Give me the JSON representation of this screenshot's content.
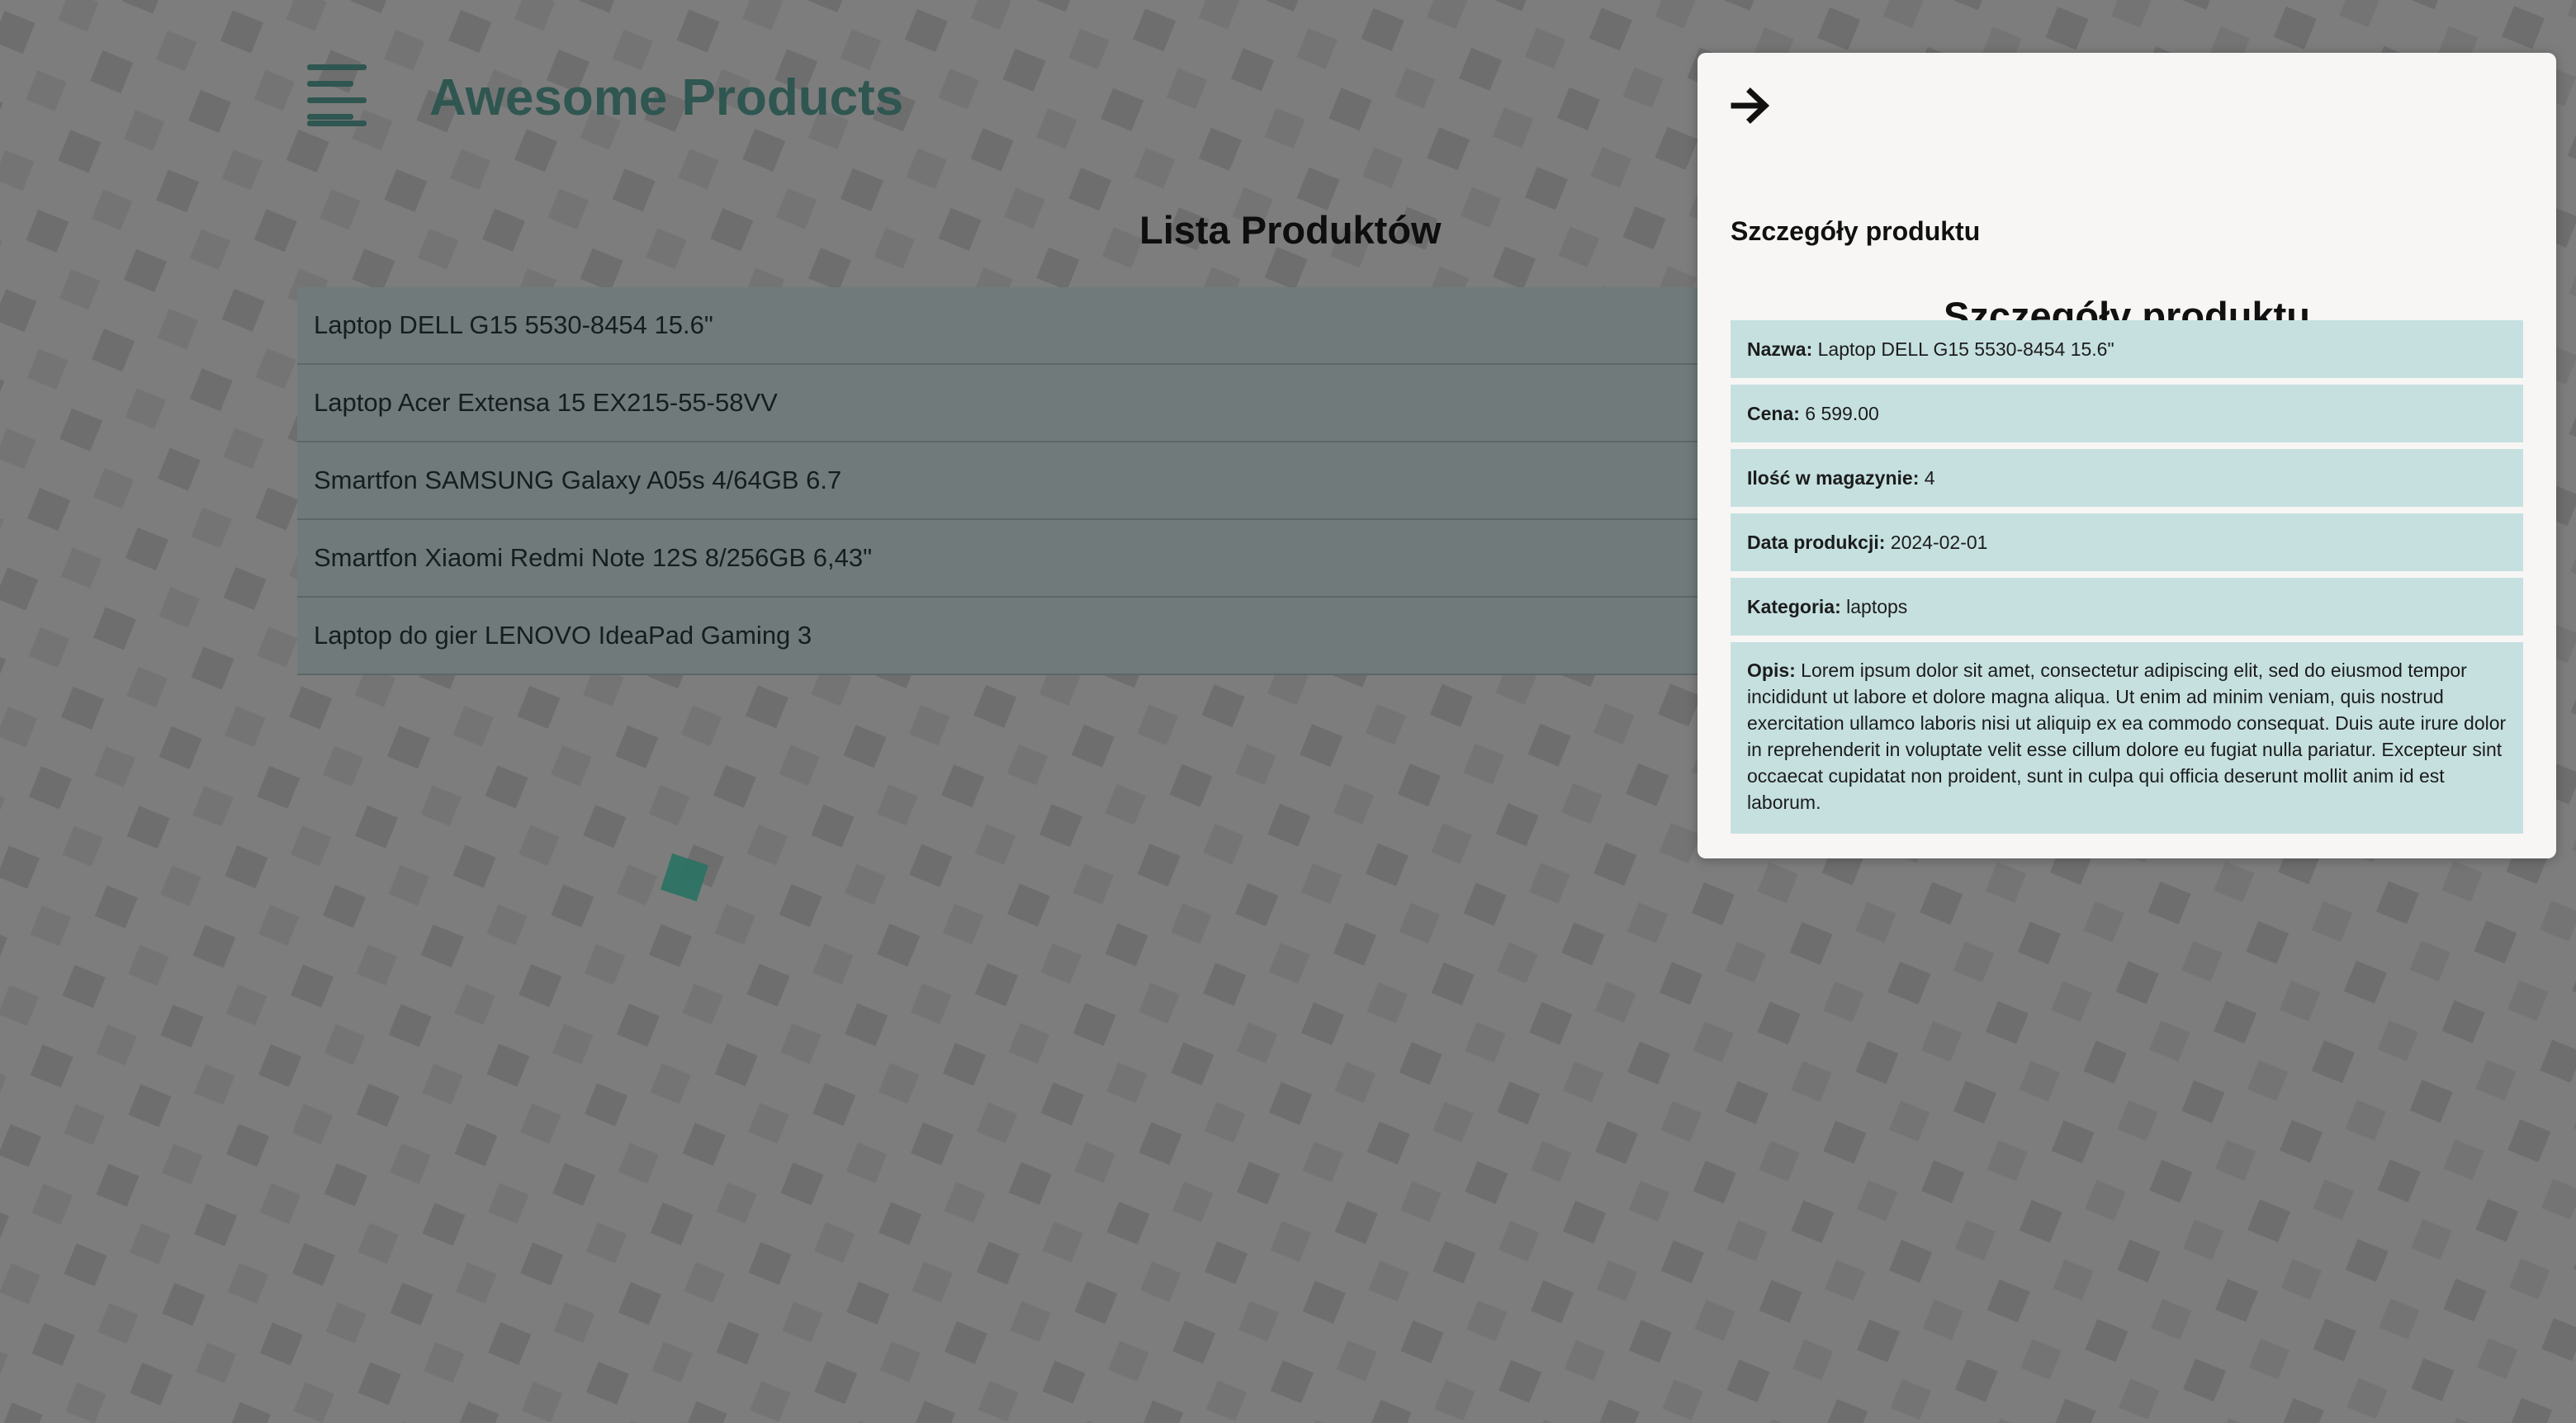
{
  "app": {
    "title": "Awesome Products",
    "menu_icon": "hamburger-menu-icon"
  },
  "products": {
    "heading": "Lista Produktów",
    "items": [
      "Laptop DELL G15 5530-8454 15.6\"",
      "Laptop Acer Extensa 15 EX215-55-58VV",
      "Smartfon SAMSUNG Galaxy A05s 4/64GB 6.7",
      "Smartfon Xiaomi Redmi Note 12S 8/256GB 6,43\"",
      "Laptop do gier LENOVO IdeaPad Gaming 3"
    ]
  },
  "details": {
    "close_icon": "arrow-right-icon",
    "title": "Szczegóły produktu",
    "heading": "Szczegóły produktu",
    "fields": [
      {
        "label": "Nazwa:",
        "value": "Laptop DELL G15 5530-8454 15.6\""
      },
      {
        "label": "Cena:",
        "value": "6 599.00"
      },
      {
        "label": "Ilość w magazynie:",
        "value": "4"
      },
      {
        "label": "Data produkcji:",
        "value": "2024-02-01"
      },
      {
        "label": "Kategoria:",
        "value": "laptops"
      },
      {
        "label": "Opis:",
        "value": "Lorem ipsum dolor sit amet, consectetur adipiscing elit, sed do eiusmod tempor incididunt ut labore et dolore magna aliqua. Ut enim ad minim veniam, quis nostrud exercitation ullamco laboris nisi ut aliquip ex ea commodo consequat. Duis aute irure dolor in reprehenderit in voluptate velit esse cillum dolore eu fugiat nulla pariatur. Excepteur sint occaecat cupidatat non proident, sunt in culpa qui officia deserunt mollit anim id est laborum."
      }
    ]
  },
  "colors": {
    "brand": "#2f5650",
    "list_row": "#707a7b",
    "panel_bg": "#f7f6f4",
    "detail_row": "#c6e0e0",
    "backdrop": "#7b7b7b"
  }
}
